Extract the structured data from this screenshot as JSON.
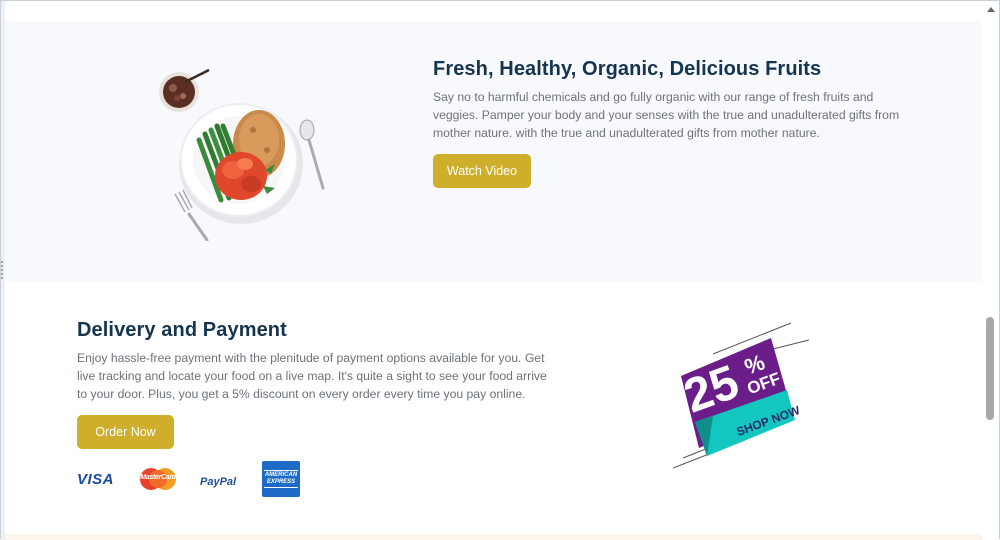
{
  "fruits_section": {
    "title": "Fresh, Healthy, Organic, Delicious Fruits",
    "description": "Say no to harmful chemicals and go fully organic with our range of fresh fruits and veggies. Pamper your body and your senses with the true and unadulterated gifts from mother nature. with the true and unadulterated gifts from mother nature.",
    "button_label": "Watch Video",
    "image_icon": "food-plate-illustration"
  },
  "delivery_section": {
    "title": "Delivery and Payment",
    "description": "Enjoy hassle-free payment with the plenitude of payment options available for you. Get live tracking and locate your food on a live map. It's quite a sight to see your food arrive to your door. Plus, you get a 5% discount on every order every time you pay online.",
    "button_label": "Order Now",
    "payment_methods": [
      {
        "name": "visa",
        "label": "VISA"
      },
      {
        "name": "mastercard",
        "label": "MasterCard"
      },
      {
        "name": "paypal",
        "label": "PayPal"
      },
      {
        "name": "amex",
        "label": "AMERICAN EXPRESS"
      }
    ],
    "promo": {
      "discount": "25",
      "percent": "%",
      "off": "OFF",
      "cta": "SHOP NOW"
    }
  },
  "colors": {
    "accent": "#cfae2b",
    "heading": "#15344f",
    "text": "#6c7379",
    "promo_purple": "#6b1e8a",
    "promo_teal": "#13c7c0",
    "section_bg": "#f8f9fc"
  }
}
